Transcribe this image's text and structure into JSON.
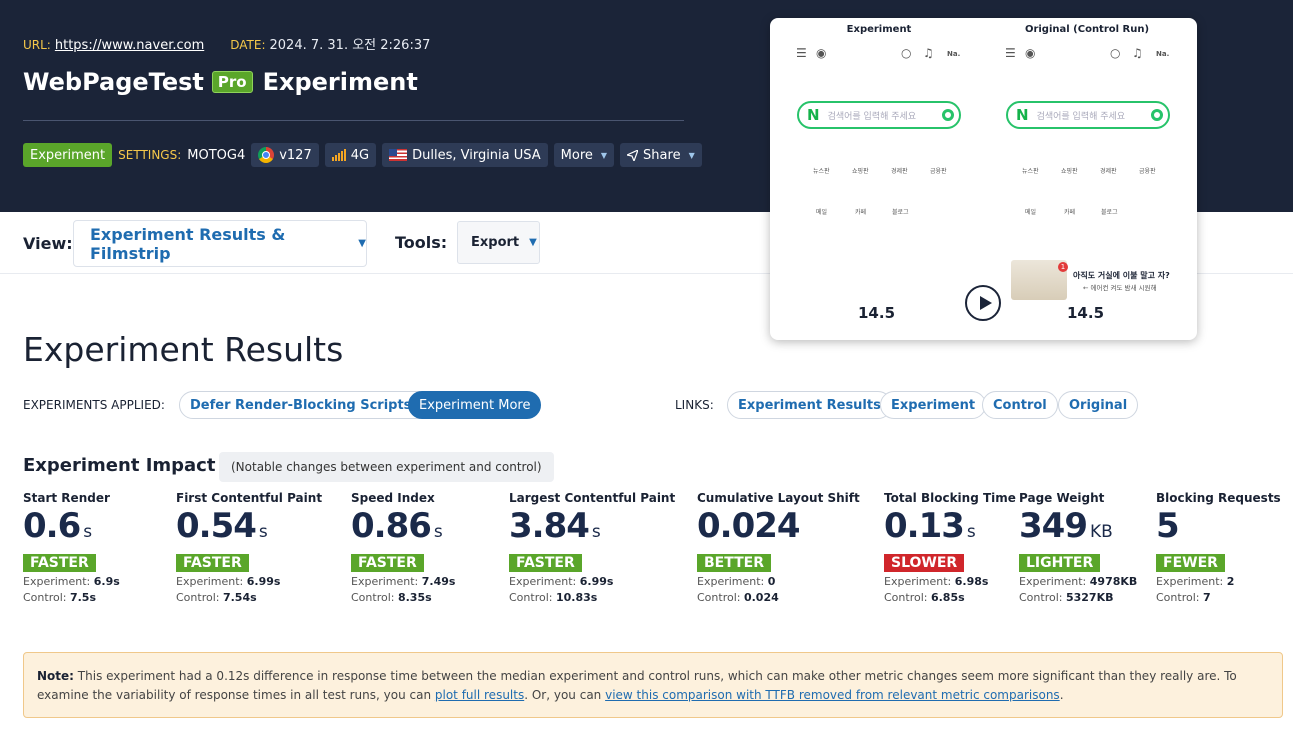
{
  "header": {
    "url_label": "URL:",
    "url": "https://www.naver.com",
    "date_label": "DATE:",
    "date": "2024. 7. 31. 오전 2:26:37",
    "brand": "WebPageTest",
    "pro": "Pro",
    "page_heading": "Experiment",
    "experiment_tag": "Experiment",
    "settings_label": "SETTINGS:",
    "device": "MOTOG4",
    "browser_version": "v127",
    "connection": "4G",
    "location": "Dulles, Virginia USA",
    "more": "More",
    "share": "Share",
    "icons": [
      "chrome-icon",
      "signal-icon",
      "us-flag-icon",
      "share-icon"
    ]
  },
  "toolbar": {
    "view_label": "View:",
    "view_value": "Experiment Results & Filmstrip",
    "tools_label": "Tools:",
    "tools_value": "Export"
  },
  "filmstrip": {
    "left_title": "Experiment",
    "right_title": "Original (Control Run)",
    "search_placeholder": "검색어를 입력해 주세요",
    "na_label": "Na.",
    "menu_row1": [
      "뉴스판",
      "쇼핑판",
      "경제판",
      "금융판"
    ],
    "menu_row2": [
      "메일",
      "카페",
      "블로그"
    ],
    "ad_text": "아직도 거실에 이불 말고 자?",
    "ad_sub": "← 에어컨 켜도 밤새 시원해",
    "ad_badge": "1",
    "left_time": "14.5",
    "right_time": "14.5"
  },
  "results": {
    "title": "Experiment Results",
    "experiments_label": "EXPERIMENTS APPLIED:",
    "experiment_chip": "Defer Render-Blocking Scripts",
    "experiment_more": "Experiment More",
    "links_label": "LINKS:",
    "links": [
      "Experiment Results",
      "Experiment",
      "Control",
      "Original"
    ]
  },
  "impact": {
    "title": "Experiment Impact",
    "subtitle": "(Notable changes between experiment and control)",
    "exp_label": "Experiment:",
    "ctl_label": "Control:",
    "metrics": [
      {
        "name": "Start Render",
        "value": "0.6",
        "unit": "s",
        "badge": "FASTER",
        "experiment": "6.9s",
        "control": "7.5s"
      },
      {
        "name": "First Contentful Paint",
        "value": "0.54",
        "unit": "s",
        "badge": "FASTER",
        "experiment": "6.99s",
        "control": "7.54s"
      },
      {
        "name": "Speed Index",
        "value": "0.86",
        "unit": "s",
        "badge": "FASTER",
        "experiment": "7.49s",
        "control": "8.35s"
      },
      {
        "name": "Largest Contentful Paint",
        "value": "3.84",
        "unit": "s",
        "badge": "FASTER",
        "experiment": "6.99s",
        "control": "10.83s"
      },
      {
        "name": "Cumulative Layout Shift",
        "value": "0.024",
        "unit": "",
        "badge": "BETTER",
        "experiment": "0",
        "control": "0.024"
      },
      {
        "name": "Total Blocking Time",
        "value": "0.13",
        "unit": "s",
        "badge": "SLOWER",
        "experiment": "6.98s",
        "control": "6.85s"
      },
      {
        "name": "Page Weight",
        "value": "349",
        "unit": "KB",
        "badge": "LIGHTER",
        "experiment": "4978KB",
        "control": "5327KB"
      },
      {
        "name": "Blocking Requests",
        "value": "5",
        "unit": "",
        "badge": "FEWER",
        "experiment": "2",
        "control": "7"
      }
    ],
    "colors": {
      "positive": "#5aa62a",
      "negative": "#d0262b"
    }
  },
  "note": {
    "label": "Note:",
    "text1": "This experiment had a 0.12s difference in response time between the median experiment and control runs, which can make other metric changes seem more significant than they really are. To examine the variability of response times in all test runs, you can",
    "link1": "plot full results",
    "text2": ". Or, you can",
    "link2": "view this comparison with TTFB removed from relevant metric comparisons",
    "text3": "."
  }
}
